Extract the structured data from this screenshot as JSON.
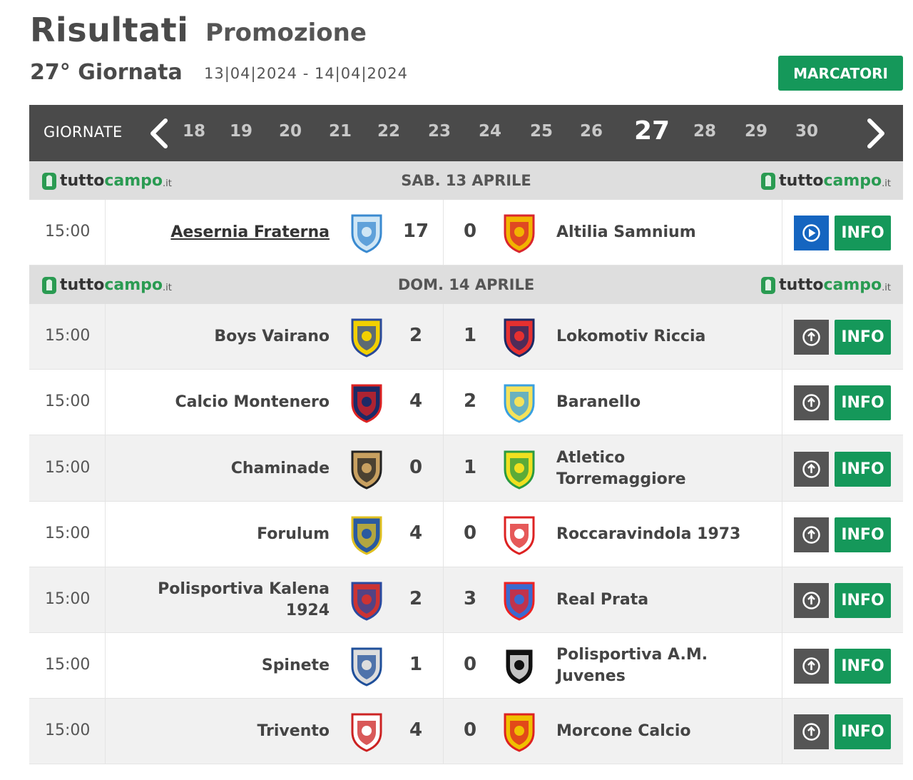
{
  "header": {
    "title": "Risultati",
    "subtitle": "Promozione",
    "giornata": "27° Giornata",
    "dates": "13|04|2024 - 14|04|2024",
    "marcatori_label": "MARCATORI"
  },
  "nav": {
    "label": "GIORNATE",
    "numbers": [
      "18",
      "19",
      "20",
      "21",
      "22",
      "23",
      "24",
      "25",
      "26",
      "27",
      "28",
      "29",
      "30"
    ],
    "active": "27"
  },
  "brand": {
    "w1": "tutto",
    "w2": "campo",
    "w3": ".it"
  },
  "days": [
    {
      "label": "SAB. 13 APRILE",
      "matches": [
        {
          "time": "15:00",
          "home": "Aesernia Fraterna",
          "home_score": "17",
          "away_score": "0",
          "away": "Altilia Samnium",
          "action_icon": "play-icon",
          "info": "INFO"
        }
      ]
    },
    {
      "label": "DOM. 14 APRILE",
      "matches": [
        {
          "time": "15:00",
          "home": "Boys Vairano",
          "home_score": "2",
          "away_score": "1",
          "away": "Lokomotiv Riccia",
          "action_icon": "upload-icon",
          "info": "INFO"
        },
        {
          "time": "15:00",
          "home": "Calcio Montenero",
          "home_score": "4",
          "away_score": "2",
          "away": "Baranello",
          "action_icon": "upload-icon",
          "info": "INFO"
        },
        {
          "time": "15:00",
          "home": "Chaminade",
          "home_score": "0",
          "away_score": "1",
          "away": "Atletico Torremaggiore",
          "action_icon": "upload-icon",
          "info": "INFO"
        },
        {
          "time": "15:00",
          "home": "Forulum",
          "home_score": "4",
          "away_score": "0",
          "away": "Roccaravindola 1973",
          "action_icon": "upload-icon",
          "info": "INFO"
        },
        {
          "time": "15:00",
          "home": "Polisportiva Kalena 1924",
          "home_score": "2",
          "away_score": "3",
          "away": "Real Prata",
          "action_icon": "upload-icon",
          "info": "INFO"
        },
        {
          "time": "15:00",
          "home": "Spinete",
          "home_score": "1",
          "away_score": "0",
          "away": "Polisportiva A.M. Juvenes",
          "action_icon": "upload-icon",
          "info": "INFO"
        },
        {
          "time": "15:00",
          "home": "Trivento",
          "home_score": "4",
          "away_score": "0",
          "away": "Morcone Calcio",
          "action_icon": "upload-icon",
          "info": "INFO"
        }
      ]
    }
  ],
  "colors": {
    "green": "#15985a",
    "dark": "#4a4a4a",
    "blue": "#1565c0"
  }
}
